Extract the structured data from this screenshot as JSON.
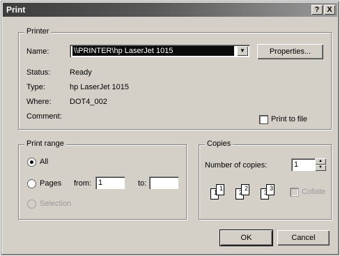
{
  "title": "Print",
  "title_buttons": {
    "help": "?",
    "close": "X"
  },
  "printer": {
    "group_label": "Printer",
    "name_label": "Name:",
    "name_value": "\\\\PRINTER\\hp LaserJet 1015",
    "properties_button": "Properties...",
    "status_label": "Status:",
    "status_value": "Ready",
    "type_label": "Type:",
    "type_value": "hp LaserJet 1015",
    "where_label": "Where:",
    "where_value": "DOT4_002",
    "comment_label": "Comment:",
    "print_to_file_label": "Print to file",
    "print_to_file_checked": false
  },
  "print_range": {
    "group_label": "Print range",
    "all_label": "All",
    "all_selected": true,
    "pages_label": "Pages",
    "from_label": "from:",
    "from_value": "1",
    "to_label": "to:",
    "to_value": "",
    "selection_label": "Selection"
  },
  "copies": {
    "group_label": "Copies",
    "number_label": "Number of copies:",
    "number_value": "1",
    "collate_label": "Collate",
    "collate_page_labels": [
      "1",
      "1",
      "2",
      "2",
      "3",
      "3"
    ]
  },
  "buttons": {
    "ok": "OK",
    "cancel": "Cancel"
  }
}
